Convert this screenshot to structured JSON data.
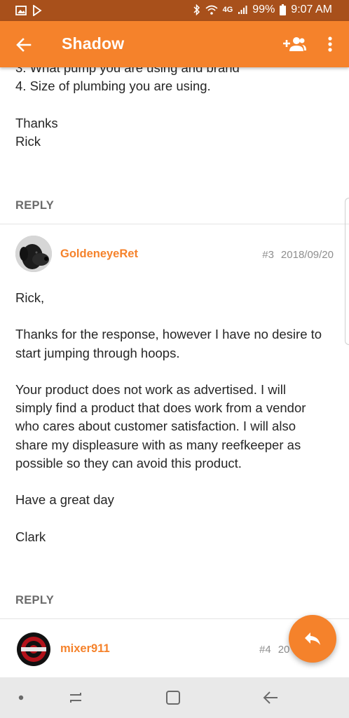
{
  "status_bar": {
    "network": "4G",
    "battery": "99%",
    "time": "9:07 AM",
    "icons": [
      "gallery-icon",
      "play-store-icon",
      "bluetooth-icon",
      "wifi-icon",
      "signal-icon",
      "battery-icon"
    ]
  },
  "app_bar": {
    "title": "Shadow",
    "icons": [
      "back-arrow-icon",
      "add-person-icon",
      "more-vert-icon"
    ]
  },
  "posts": [
    {
      "partial_top_line": "3. What pump you are using and brand",
      "lines": [
        "4. Size of plumbing you are using.",
        "",
        "Thanks",
        "Rick"
      ],
      "reply_label": "REPLY"
    },
    {
      "author": "GoldeneyeRet",
      "number": "#3",
      "date": "2018/09/20",
      "lines": [
        "Rick,",
        "",
        "Thanks for the response, however I have no desire to",
        "start jumping through hoops.",
        "",
        "Your product does not work as advertised. I will",
        "simply find a product that does work from a vendor",
        "who cares about customer satisfaction. I will also",
        "share my displeasure with as many reefkeeper as",
        "possible so they can avoid this product.",
        "",
        "Have a great day",
        "",
        "Clark"
      ],
      "reply_label": "REPLY"
    },
    {
      "author": "mixer911",
      "number": "#4",
      "date_partial": "20"
    }
  ],
  "fab": {
    "icon": "reply-icon"
  },
  "nav_bar": {
    "icons": [
      "dot-icon",
      "recent-apps-icon",
      "home-icon",
      "back-icon"
    ]
  },
  "colors": {
    "accent": "#f5822b",
    "status_bar": "#a8501b",
    "nav_bar": "#e9e9e9"
  }
}
